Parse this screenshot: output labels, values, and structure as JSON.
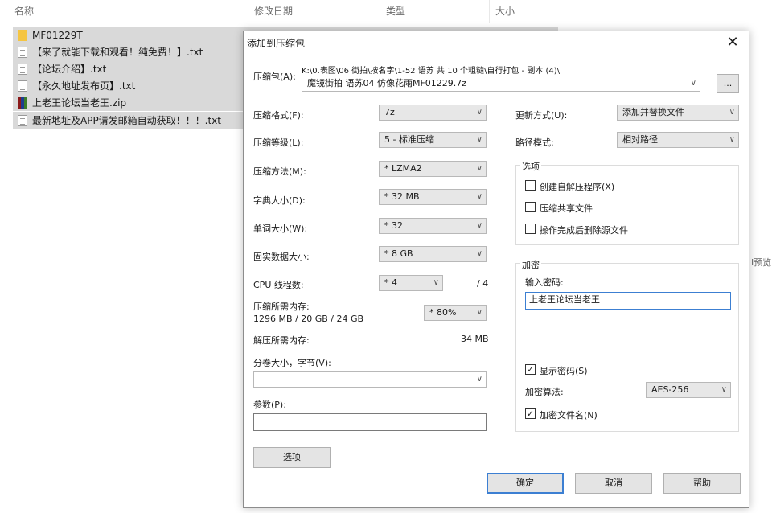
{
  "explorer": {
    "columns": [
      "名称",
      "修改日期",
      "类型",
      "大小"
    ],
    "files": [
      {
        "name": "MF01229T",
        "icon": "folder-icon"
      },
      {
        "name": "【来了就能下载和观看！纯免费！】.txt",
        "icon": "text-file-icon"
      },
      {
        "name": "【论坛介绍】.txt",
        "icon": "text-file-icon"
      },
      {
        "name": "【永久地址发布页】.txt",
        "icon": "text-file-icon"
      },
      {
        "name": "上老王论坛当老王.zip",
        "icon": "zip-file-icon"
      },
      {
        "name": "最新地址及APP请发邮箱自动获取！！！.txt",
        "icon": "text-file-icon"
      }
    ],
    "stray_text": "I预览"
  },
  "dialog": {
    "title": "添加到压缩包",
    "close": "✕",
    "archive_label": "压缩包(A):",
    "archive_path": "K:\\0.表图\\06 街拍\\按名字\\1-52 语苏   共 10 个粗糙\\自行打包 - 副本 (4)\\",
    "archive_name": "魔镜街拍 语苏04 仿像花雨MF01229.7z",
    "browse_label": "...",
    "format_label": "压缩格式(F):",
    "format_value": "7z",
    "level_label": "压缩等级(L):",
    "level_value": "5 - 标准压缩",
    "method_label": "压缩方法(M):",
    "method_value": "* LZMA2",
    "dict_label": "字典大小(D):",
    "dict_value": "* 32 MB",
    "word_label": "单词大小(W):",
    "word_value": "* 32",
    "solid_label": "固实数据大小:",
    "solid_value": "* 8 GB",
    "cpu_label": "CPU 线程数:",
    "cpu_value": "* 4",
    "cpu_total": "/ 4",
    "mem_comp_label": "压缩所需内存:",
    "mem_comp_value": "1296 MB / 20 GB / 24 GB",
    "mem_percent": "* 80%",
    "mem_decomp_label": "解压所需内存:",
    "mem_decomp_value": "34 MB",
    "split_label": "分卷大小，字节(V):",
    "split_value": "",
    "params_label": "参数(P):",
    "params_value": "",
    "options_button": "选项",
    "update_label": "更新方式(U):",
    "update_value": "添加并替换文件",
    "path_label": "路径模式:",
    "path_value": "相对路径",
    "options_group": "选项",
    "opt_sfx": "创建自解压程序(X)",
    "opt_shared": "压缩共享文件",
    "opt_delete": "操作完成后删除源文件",
    "enc_group": "加密",
    "password_label": "输入密码:",
    "password_value": "上老王论坛当老王",
    "show_password": "显示密码(S)",
    "enc_method_label": "加密算法:",
    "enc_method_value": "AES-256",
    "enc_filenames": "加密文件名(N)",
    "ok": "确定",
    "cancel": "取消",
    "help": "帮助"
  }
}
